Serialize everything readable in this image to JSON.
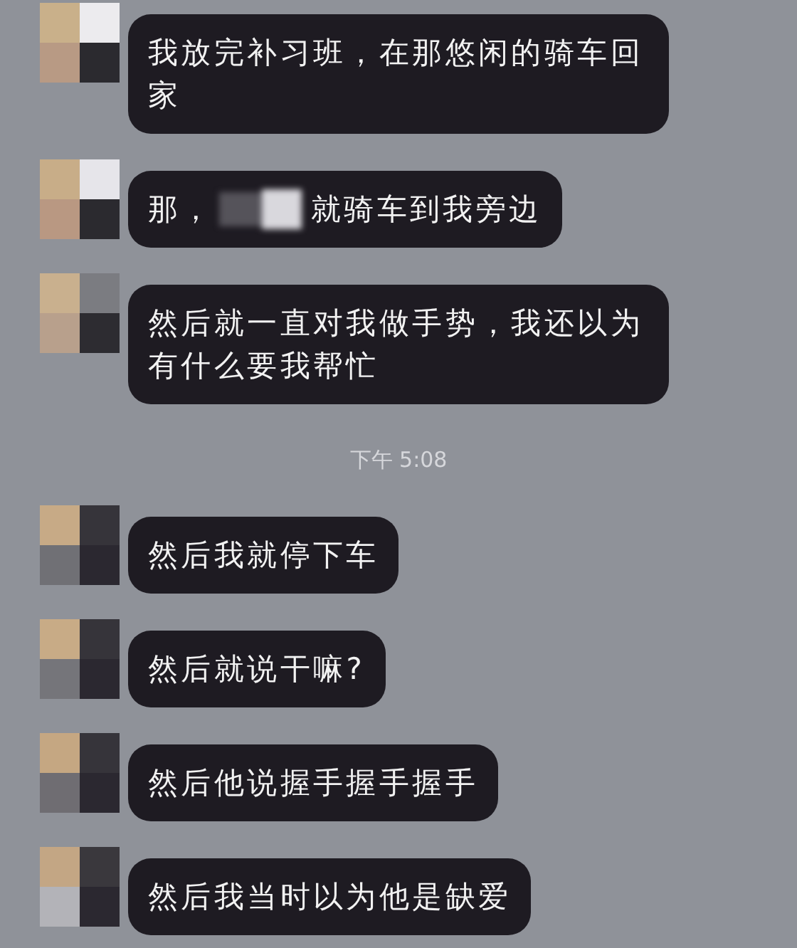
{
  "messages": [
    {
      "kind": "text",
      "parts": [
        "我放完补习班，在那悠闲的骑车回家"
      ]
    },
    {
      "kind": "redacted",
      "parts": [
        "那，",
        "就骑车到我旁边"
      ]
    },
    {
      "kind": "text",
      "parts": [
        "然后就一直对我做手势，我还以为有什么要我帮忙"
      ]
    },
    {
      "kind": "time",
      "parts": [
        "下午 5:08"
      ]
    },
    {
      "kind": "text",
      "parts": [
        "然后我就停下车"
      ]
    },
    {
      "kind": "text",
      "parts": [
        "然后就说干嘛?"
      ]
    },
    {
      "kind": "text",
      "parts": [
        "然后他说握手握手握手"
      ]
    },
    {
      "kind": "text",
      "parts": [
        "然后我当时以为他是缺爱"
      ]
    }
  ]
}
